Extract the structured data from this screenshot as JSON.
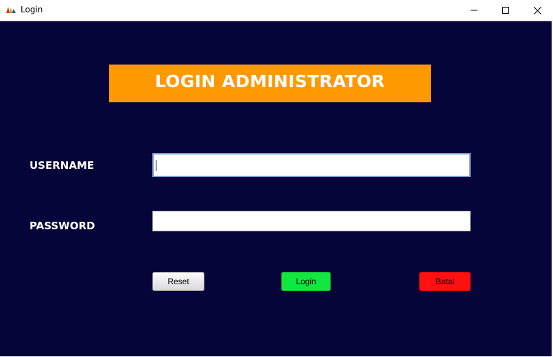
{
  "window": {
    "title": "Login",
    "icon": "java-app-icon",
    "controls": [
      "minimize-icon",
      "maximize-icon",
      "close-icon"
    ]
  },
  "header": {
    "title": "LOGIN ADMINISTRATOR"
  },
  "form": {
    "username_label": "USERNAME",
    "username_value": "",
    "password_label": "PASSWORD",
    "password_value": ""
  },
  "buttons": {
    "reset_label": "Reset",
    "login_label": "Login",
    "batal_label": "Batal"
  },
  "colors": {
    "background": "#05053a",
    "banner": "#ff9900",
    "login_button": "#14e640",
    "batal_button": "#ff1111"
  }
}
